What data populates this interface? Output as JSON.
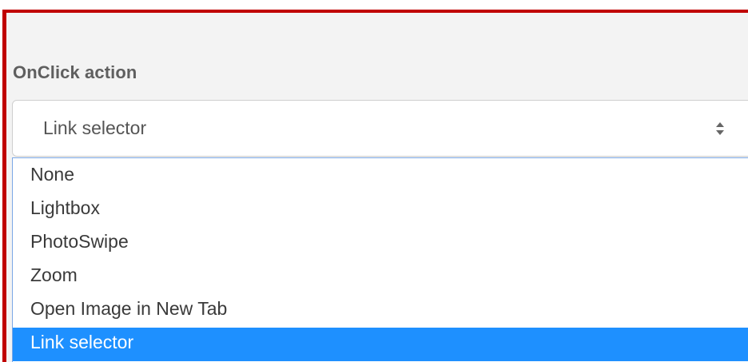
{
  "field": {
    "label": "OnClick action",
    "selected_value": "Link selector"
  },
  "dropdown": {
    "options": [
      {
        "label": "None"
      },
      {
        "label": "Lightbox"
      },
      {
        "label": "PhotoSwipe"
      },
      {
        "label": "Zoom"
      },
      {
        "label": "Open Image in New Tab"
      },
      {
        "label": "Link selector",
        "selected": true
      }
    ]
  },
  "colors": {
    "highlight": "#1e90ff",
    "frame_border": "#c00000",
    "label_text": "#5f5f5f"
  },
  "icons": {
    "select_arrows": "up-down-arrows-icon"
  }
}
